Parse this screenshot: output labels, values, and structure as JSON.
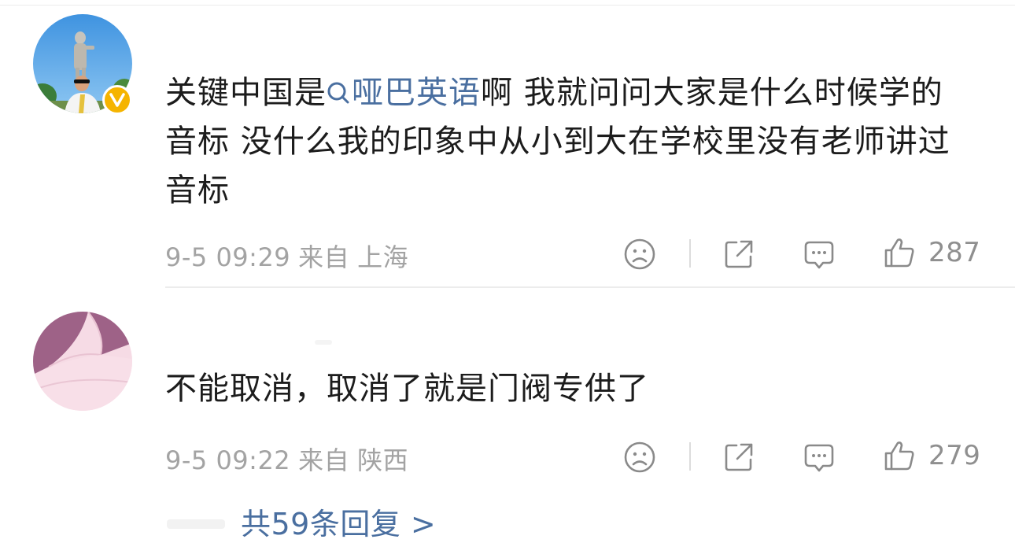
{
  "comments": [
    {
      "text_before": "关键中国是",
      "topic_link": "哑巴英语",
      "text_after": "啊 我就问问大家是什么时候学的音标 没什么我的印象中从小到大在学校里没有老师讲过音标",
      "date": "9-5 09:29",
      "from_label": "来自",
      "location": "上海",
      "likes": "287",
      "verified": true
    },
    {
      "text": "不能取消，取消了就是门阀专供了",
      "date": "9-5 09:22",
      "from_label": "来自",
      "location": "陕西",
      "likes": "279",
      "verified": false
    }
  ],
  "replies_link": "共59条回复 >",
  "icons": {
    "dislike": "sad-face-icon",
    "share": "share-icon",
    "comment": "comment-icon",
    "like": "thumbs-up-icon",
    "verified": "verified-v-icon",
    "topic": "search-icon"
  },
  "colors": {
    "link": "#4a6fa0",
    "meta": "#a3a3a3",
    "badge": "#f5b400"
  }
}
